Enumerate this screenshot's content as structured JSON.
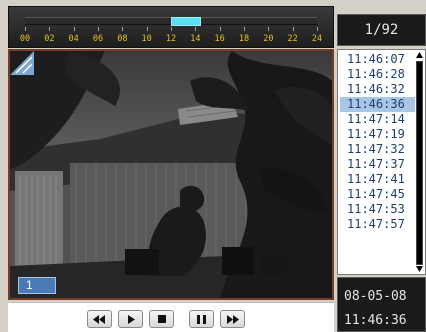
{
  "timeline": {
    "labels": [
      "00",
      "02",
      "04",
      "06",
      "08",
      "10",
      "12",
      "14",
      "16",
      "18",
      "20",
      "22",
      "24"
    ],
    "range_hours": [
      0,
      24
    ],
    "highlight_hours": [
      12.0,
      14.5
    ],
    "highlight_color": "#59dfef",
    "label_color": "#e8c020"
  },
  "video": {
    "camera_label": "1",
    "border_color": "#7a3a28",
    "badge_color": "#4b7bb6"
  },
  "controls": {
    "buttons": [
      {
        "name": "rewind-button",
        "icon": "rewind-icon"
      },
      {
        "name": "play-button",
        "icon": "play-icon"
      },
      {
        "name": "stop-button",
        "icon": "stop-icon"
      },
      {
        "name": "pause-button",
        "icon": "pause-icon"
      },
      {
        "name": "fast-forward-button",
        "icon": "fast-forward-icon"
      }
    ]
  },
  "pager": {
    "text": "1/92"
  },
  "time_list": {
    "items": [
      "11:46:07",
      "11:46:28",
      "11:46:32",
      "11:46:36",
      "11:47:14",
      "11:47:19",
      "11:47:32",
      "11:47:37",
      "11:47:41",
      "11:47:45",
      "11:47:53",
      "11:47:57"
    ],
    "selected_index": 3,
    "selection_color": "#a9c6e6"
  },
  "datetime": {
    "date": "08-05-08",
    "time": "11:46:36"
  }
}
